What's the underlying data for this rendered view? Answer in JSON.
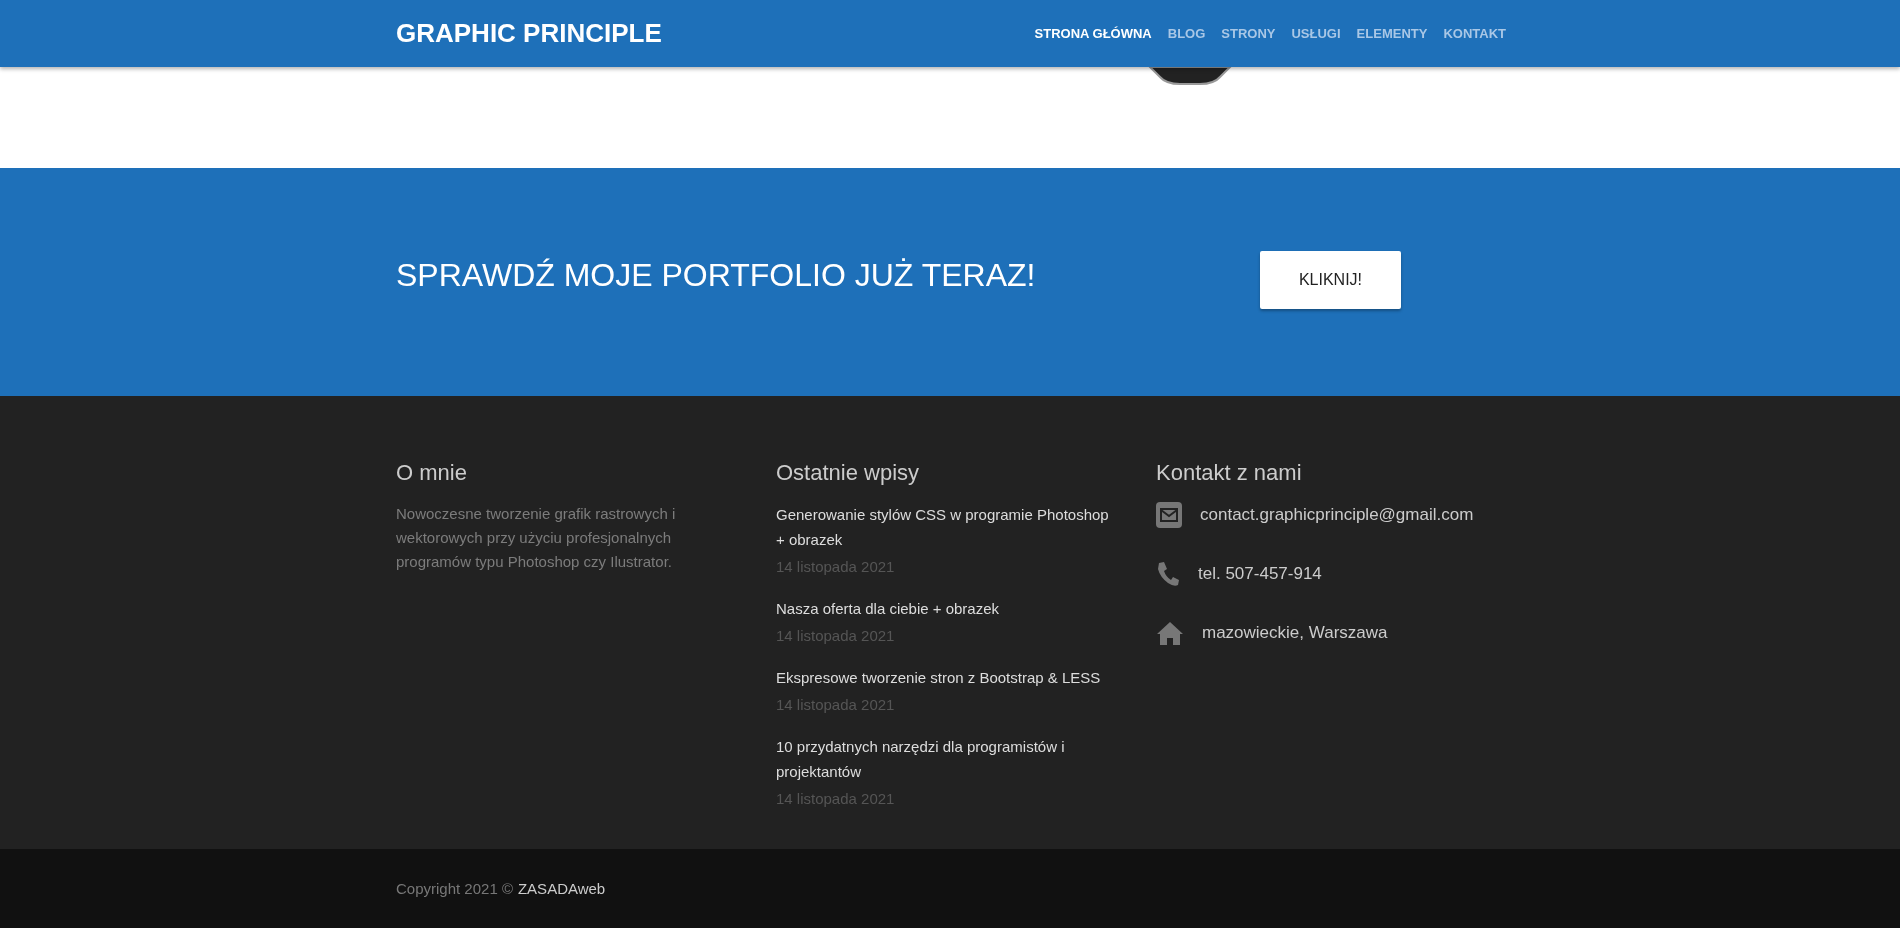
{
  "header": {
    "logo": "GRAPHIC PRINCIPLE",
    "nav": [
      {
        "label": "STRONA GŁÓWNA",
        "selected": true
      },
      {
        "label": "BLOG",
        "selected": false
      },
      {
        "label": "STRONY",
        "selected": false
      },
      {
        "label": "USŁUGI",
        "selected": false
      },
      {
        "label": "ELEMENTY",
        "selected": false
      },
      {
        "label": "KONTAKT",
        "selected": false
      }
    ]
  },
  "cta": {
    "text": "SPRAWDŹ MOJE PORTFOLIO JUŻ TERAZ!",
    "button": "KLIKNIJ!"
  },
  "footer": {
    "about": {
      "heading": "O mnie",
      "text": "Nowoczesne tworzenie grafik rastrowych i wektorowych przy użyciu profesjonalnych programów typu Photoshop czy Ilustrator."
    },
    "posts": {
      "heading": "Ostatnie wpisy",
      "items": [
        {
          "title": "Generowanie stylów CSS w programie Photoshop + obrazek",
          "date": "14 listopada 2021"
        },
        {
          "title": "Nasza oferta dla ciebie + obrazek",
          "date": "14 listopada 2021"
        },
        {
          "title": "Ekspresowe tworzenie stron z Bootstrap & LESS",
          "date": "14 listopada 2021"
        },
        {
          "title": "10 przydatnych narzędzi dla programistów i projektantów",
          "date": "14 listopada 2021"
        }
      ]
    },
    "contact": {
      "heading": "Kontakt z nami",
      "items": [
        {
          "kind": "email",
          "text": "contact.graphicprinciple@gmail.com"
        },
        {
          "kind": "phone",
          "text": "tel. 507-457-914"
        },
        {
          "kind": "address",
          "text": "mazowieckie, Warszawa"
        }
      ]
    }
  },
  "copyright": {
    "text": "Copyright 2021 ©",
    "link": "ZASADAweb"
  }
}
